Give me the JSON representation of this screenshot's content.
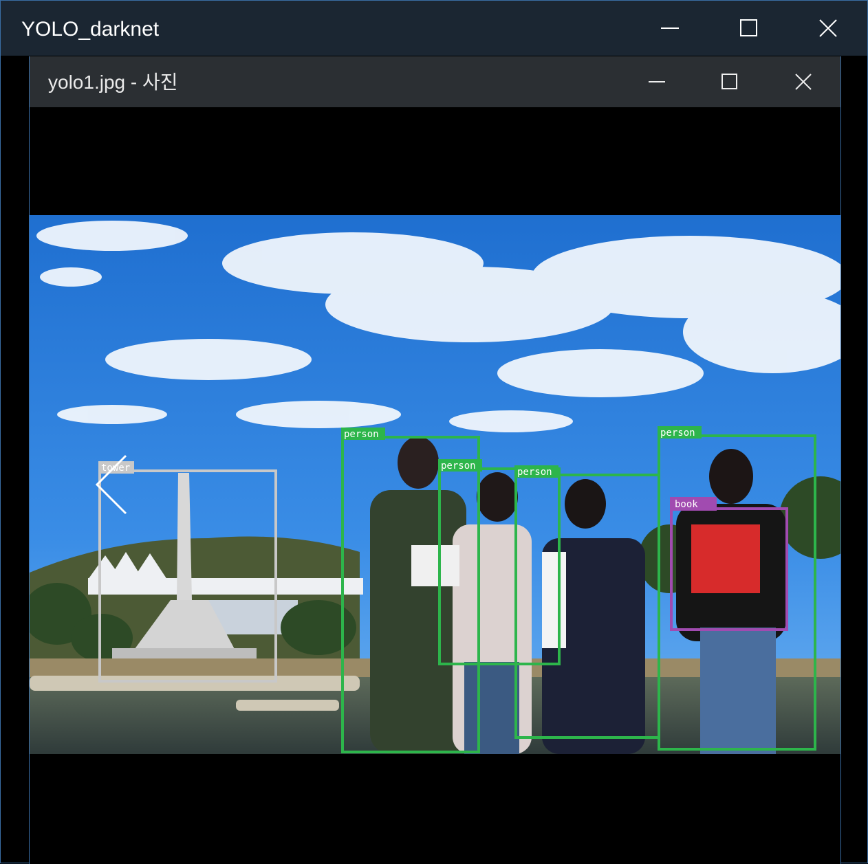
{
  "outer_window": {
    "title": "YOLO_darknet",
    "buttons": {
      "minimize": "minimize-icon",
      "maximize": "maximize-icon",
      "close": "close-icon"
    }
  },
  "photo_window": {
    "title": "yolo1.jpg - 사진",
    "buttons": {
      "minimize": "minimize-icon",
      "maximize": "maximize-icon",
      "close": "close-icon"
    },
    "nav": {
      "previous": "chevron-left-icon"
    }
  },
  "detections": [
    {
      "label": "tower",
      "color": "#c8c8c8"
    },
    {
      "label": "person",
      "color": "#2db54b"
    },
    {
      "label": "person",
      "color": "#2db54b"
    },
    {
      "label": "person",
      "color": "#2db54b"
    },
    {
      "label": "person",
      "color": "#2db54b"
    },
    {
      "label": "book",
      "color": "#a14bb0"
    }
  ],
  "colors": {
    "outer_titlebar": "#1b2632",
    "inner_titlebar": "#2b2f33",
    "window_border": "#3a6ea5",
    "sky": "#2f7fd8"
  }
}
